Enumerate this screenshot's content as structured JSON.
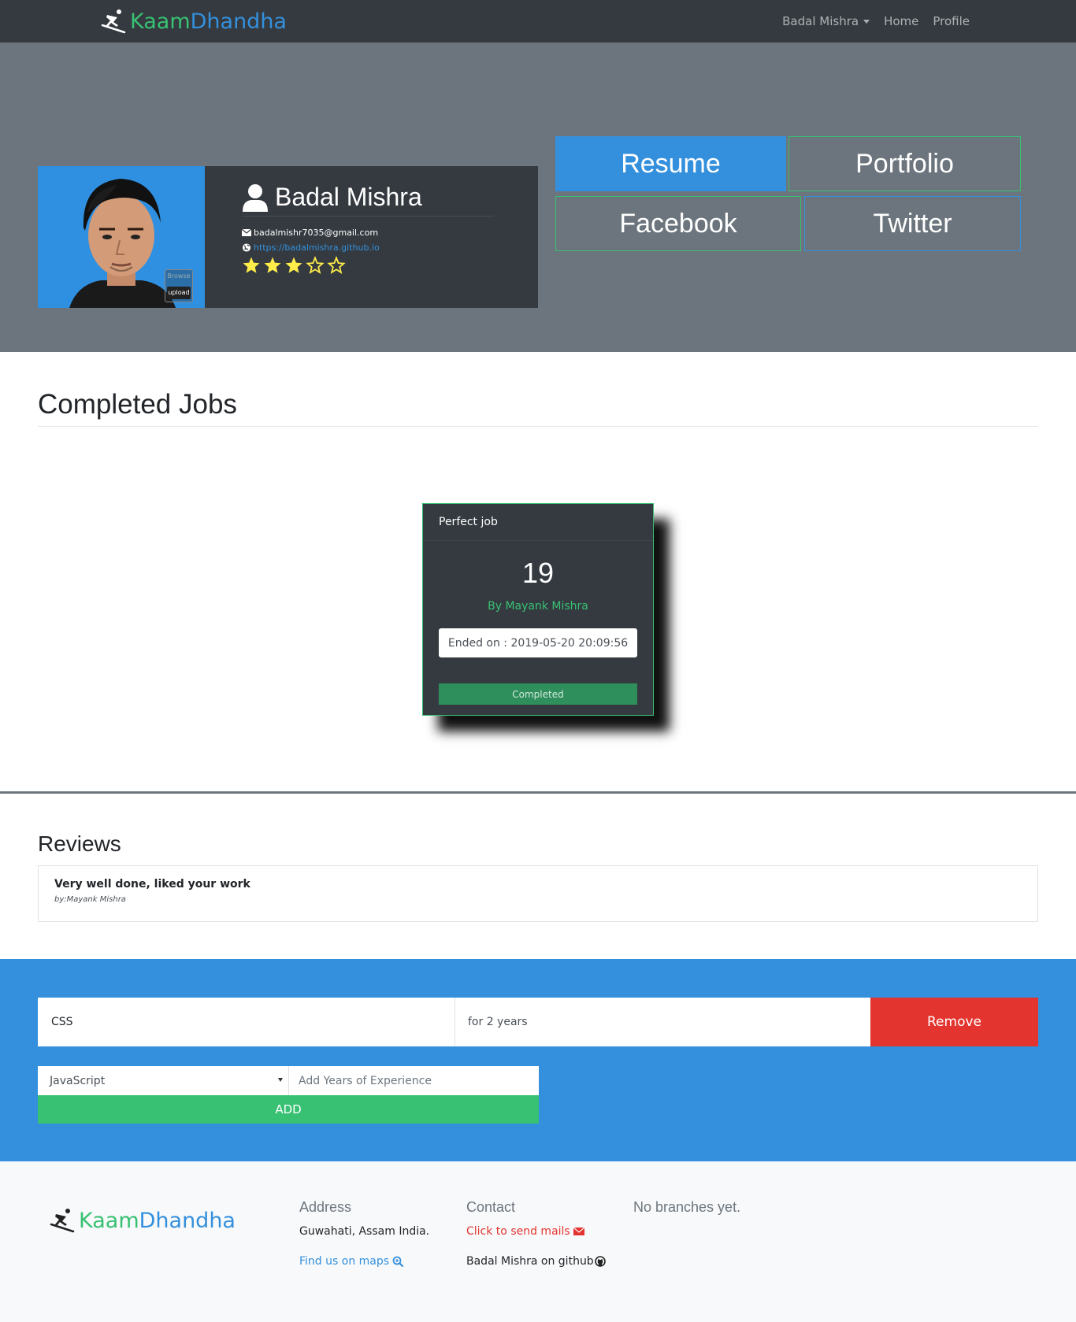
{
  "navbar": {
    "brand_part1": "Kaam",
    "brand_part2": "Dhandha",
    "user_menu": "Badal Mishra",
    "home": "Home",
    "profile": "Profile"
  },
  "profile": {
    "name": "Badal Mishra",
    "email": "badalmishr7035@gmail.com",
    "website": "https://badalmishra.github.io",
    "rating": 3,
    "rating_max": 5,
    "browse_label": "Browse",
    "upload_label": "upload"
  },
  "links": {
    "resume": "Resume",
    "portfolio": "Portfolio",
    "facebook": "Facebook",
    "twitter": "Twitter"
  },
  "completed_jobs": {
    "title": "Completed Jobs",
    "jobs": [
      {
        "title": "Perfect job",
        "number": "19",
        "by": "By Mayank Mishra",
        "ended": "Ended on : 2019-05-20 20:09:56",
        "status": "Completed"
      }
    ]
  },
  "reviews": {
    "title": "Reviews",
    "items": [
      {
        "text": "Very well done, liked your work",
        "by": "by:Mayank Mishra"
      }
    ]
  },
  "skills": {
    "items": [
      {
        "name": "CSS",
        "years": "for 2 years",
        "remove_label": "Remove"
      }
    ],
    "select_value": "JavaScript",
    "years_placeholder": "Add Years of Experience",
    "add_label": "ADD"
  },
  "footer": {
    "brand_part1": "Kaam",
    "brand_part2": "Dhandha",
    "address_head": "Address",
    "address_line": "Guwahati, Assam India.",
    "maps_link": "Find us on maps",
    "contact_head": "Contact",
    "mail_link": "Click to send mails",
    "github": "Badal Mishra on github",
    "branches": "No branches yet."
  },
  "colors": {
    "green": "#38c172",
    "blue": "#3490dc",
    "red": "#e3342f",
    "dark": "#343a40",
    "gray": "#6c757d",
    "star": "#ffed4a"
  }
}
